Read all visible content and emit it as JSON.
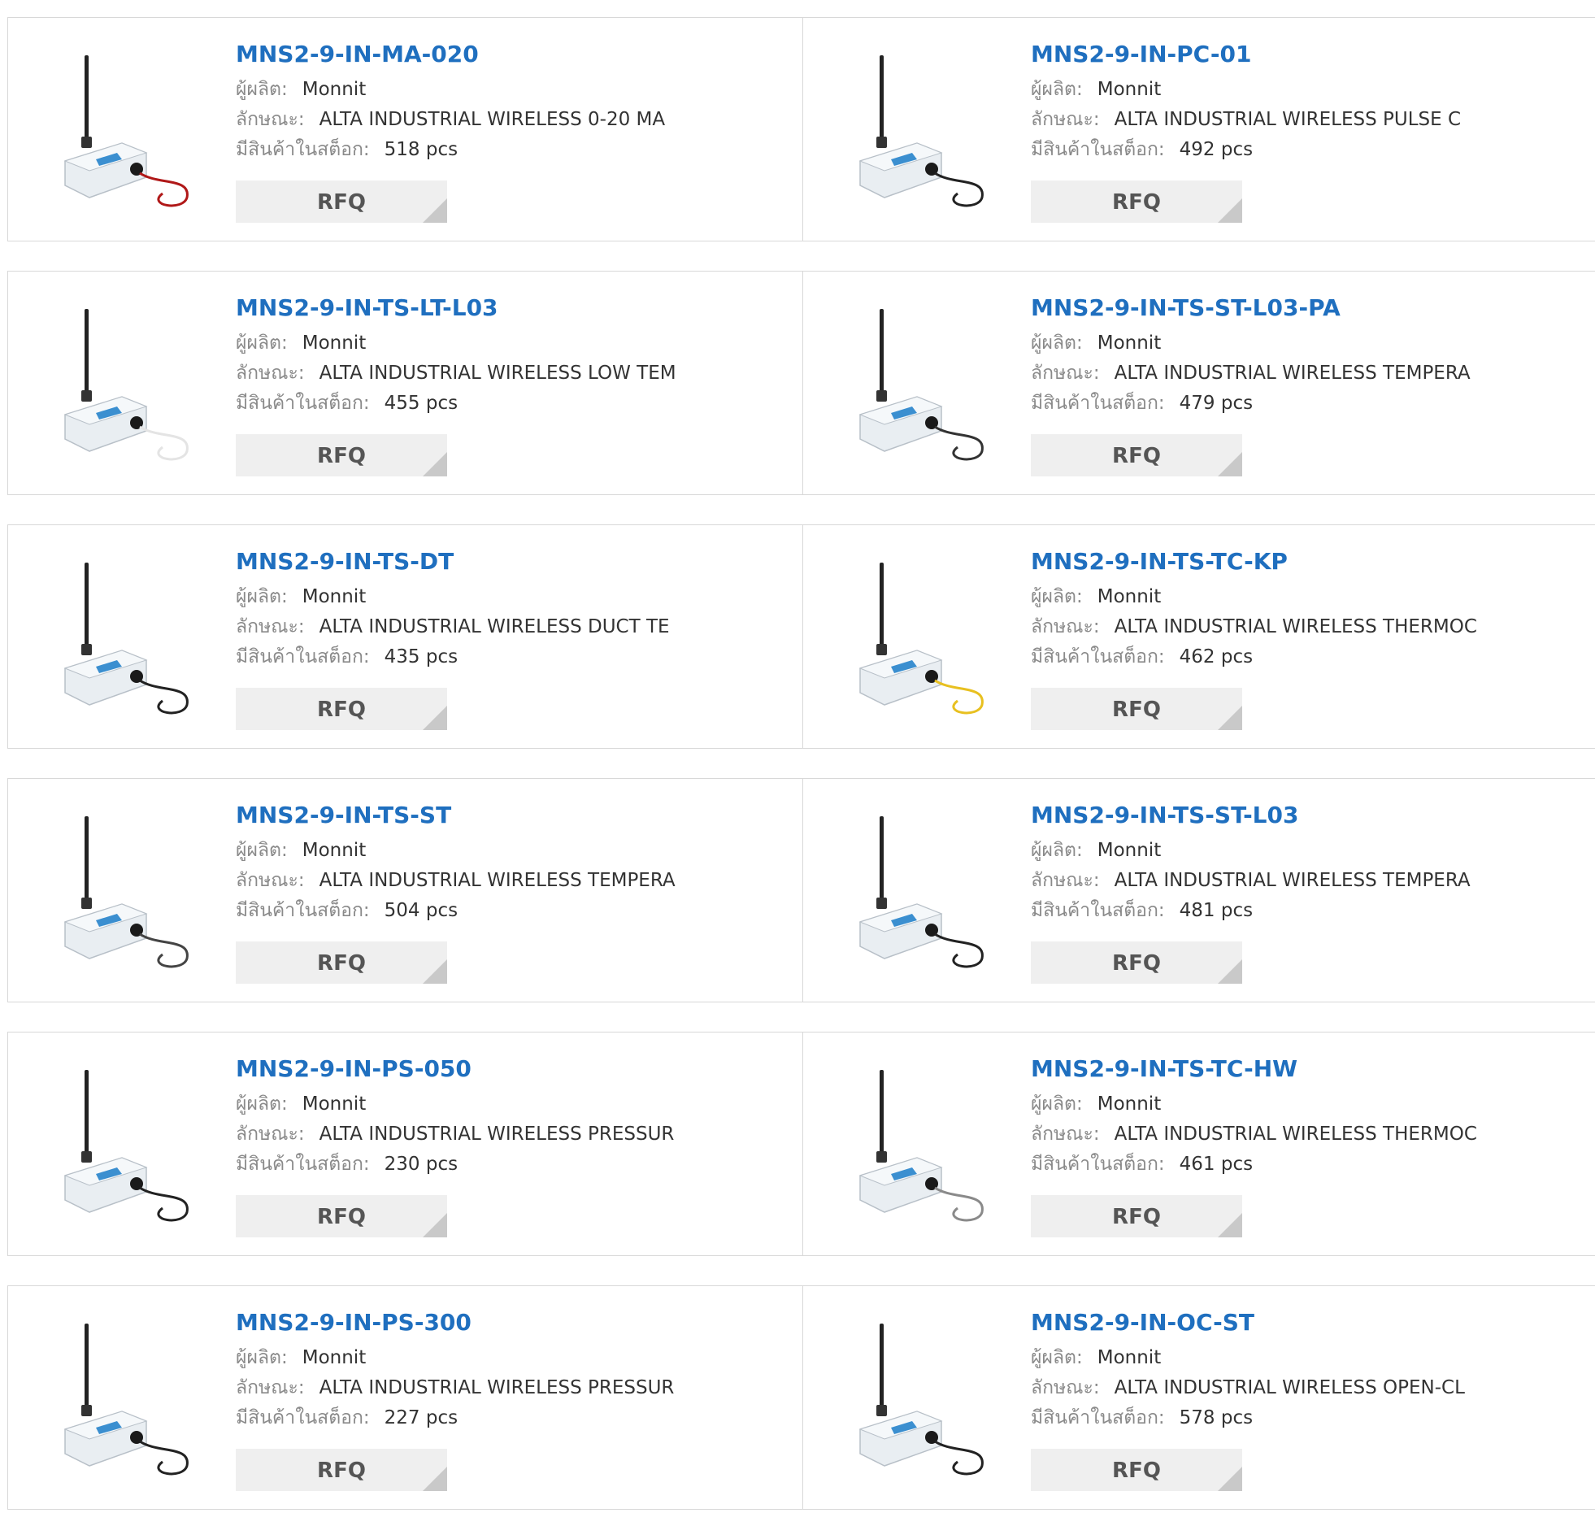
{
  "labels": {
    "manufacturer": "ผู้ผลิต:",
    "description": "ลักษณะ:",
    "stock": "มีสินค้าในสต็อก:",
    "rfq": "RFQ"
  },
  "colors": {
    "link": "#1f6fbf",
    "button_bg": "#efefef",
    "border": "#d8d8d8"
  },
  "products": [
    {
      "pn": "MNS2-9-IN-MA-020",
      "manufacturer": "Monnit",
      "description": "ALTA INDUSTRIAL WIRELESS 0-20 MA",
      "stock": "518 pcs",
      "cable": "red"
    },
    {
      "pn": "MNS2-9-IN-PC-01",
      "manufacturer": "Monnit",
      "description": "ALTA INDUSTRIAL WIRELESS PULSE C",
      "stock": "492 pcs",
      "cable": "black"
    },
    {
      "pn": "MNS2-9-IN-TS-LT-L03",
      "manufacturer": "Monnit",
      "description": "ALTA INDUSTRIAL WIRELESS LOW TEM",
      "stock": "455 pcs",
      "cable": "white"
    },
    {
      "pn": "MNS2-9-IN-TS-ST-L03-PA",
      "manufacturer": "Monnit",
      "description": "ALTA INDUSTRIAL WIRELESS TEMPERA",
      "stock": "479 pcs",
      "cable": "black-flat"
    },
    {
      "pn": "MNS2-9-IN-TS-DT",
      "manufacturer": "Monnit",
      "description": "ALTA INDUSTRIAL WIRELESS DUCT TE",
      "stock": "435 pcs",
      "cable": "black"
    },
    {
      "pn": "MNS2-9-IN-TS-TC-KP",
      "manufacturer": "Monnit",
      "description": "ALTA INDUSTRIAL WIRELESS THERMOC",
      "stock": "462 pcs",
      "cable": "yellow"
    },
    {
      "pn": "MNS2-9-IN-TS-ST",
      "manufacturer": "Monnit",
      "description": "ALTA INDUSTRIAL WIRELESS TEMPERA",
      "stock": "504 pcs",
      "cable": "probe"
    },
    {
      "pn": "MNS2-9-IN-TS-ST-L03",
      "manufacturer": "Monnit",
      "description": "ALTA INDUSTRIAL WIRELESS TEMPERA",
      "stock": "481 pcs",
      "cable": "black"
    },
    {
      "pn": "MNS2-9-IN-PS-050",
      "manufacturer": "Monnit",
      "description": "ALTA INDUSTRIAL WIRELESS PRESSUR",
      "stock": "230 pcs",
      "cable": "black"
    },
    {
      "pn": "MNS2-9-IN-TS-TC-HW",
      "manufacturer": "Monnit",
      "description": "ALTA INDUSTRIAL WIRELESS THERMOC",
      "stock": "461 pcs",
      "cable": "gray"
    },
    {
      "pn": "MNS2-9-IN-PS-300",
      "manufacturer": "Monnit",
      "description": "ALTA INDUSTRIAL WIRELESS PRESSUR",
      "stock": "227 pcs",
      "cable": "black"
    },
    {
      "pn": "MNS2-9-IN-OC-ST",
      "manufacturer": "Monnit",
      "description": "ALTA INDUSTRIAL WIRELESS OPEN-CL",
      "stock": "578 pcs",
      "cable": "black"
    }
  ]
}
